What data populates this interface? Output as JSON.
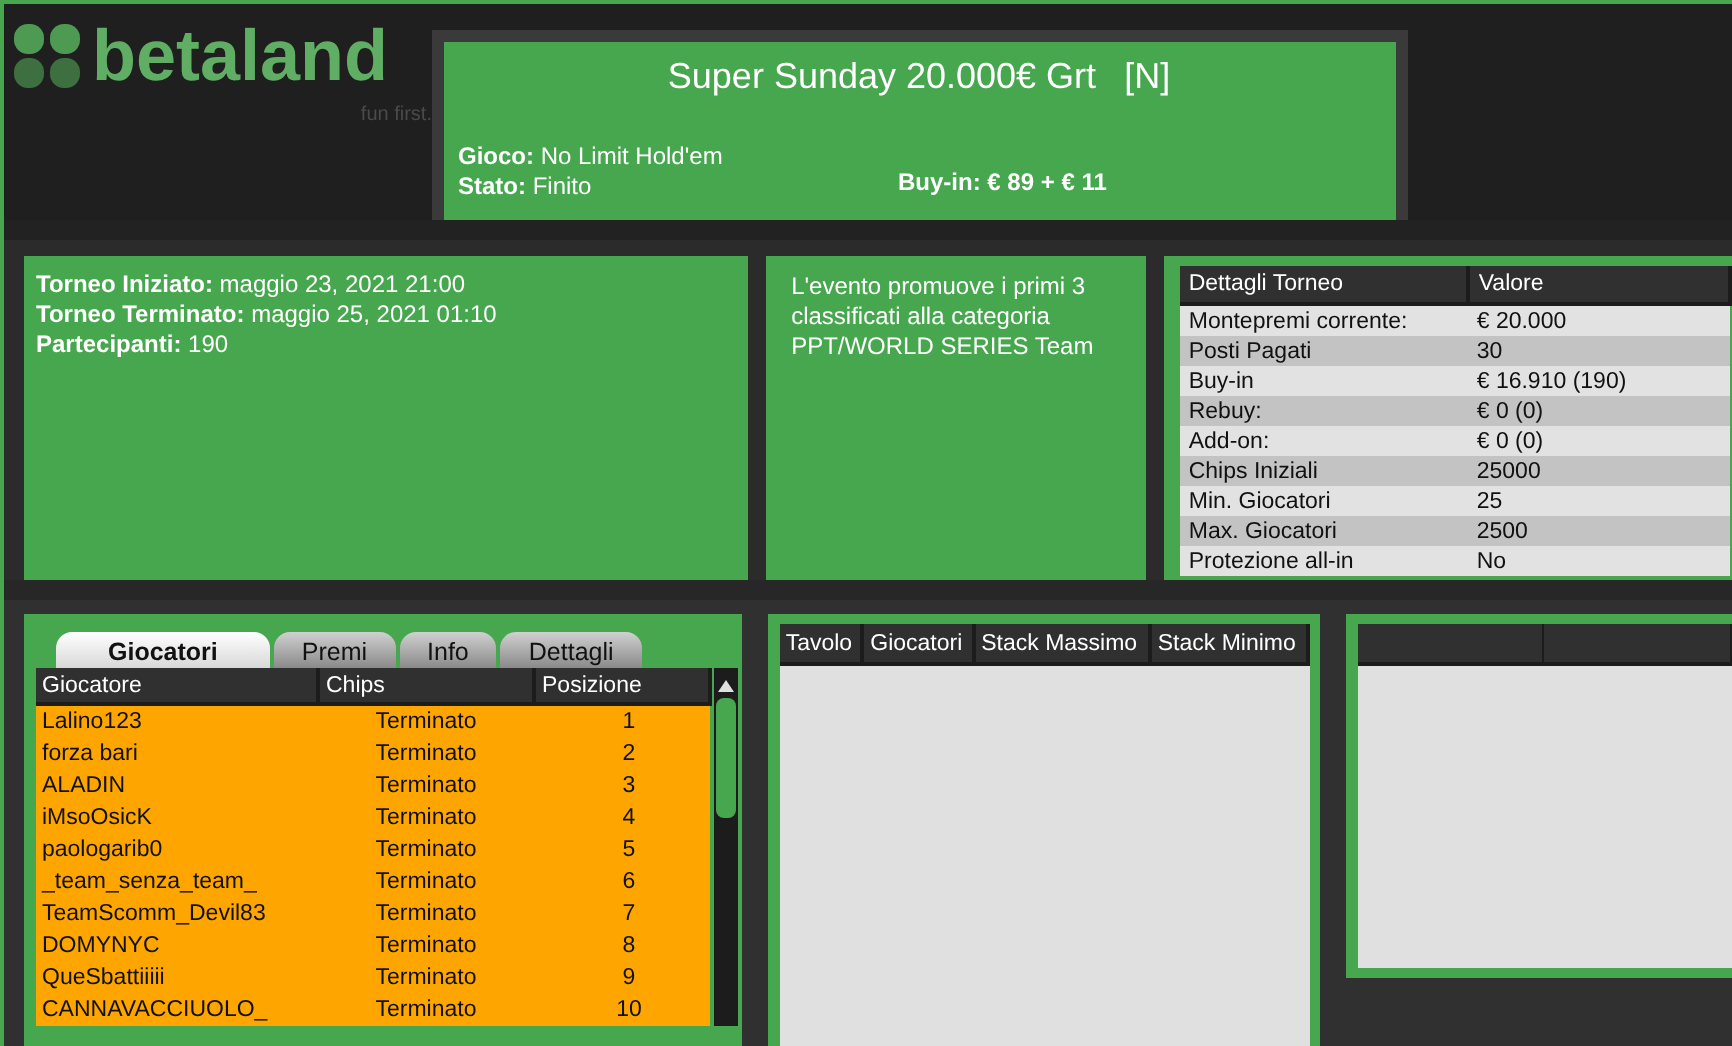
{
  "logo": {
    "name": "betaland",
    "tagline": "fun first."
  },
  "tournament": {
    "title": "Super Sunday 20.000€ Grt",
    "tag": "[N]",
    "info": [
      "**Gioco:** No Limit Hold'em",
      "**Stato:** Finito"
    ],
    "buy_in": "Buy-in: € 89 + € 11"
  },
  "schedule": [
    "**Torneo Iniziato:** maggio 23, 2021 21:00",
    "**Torneo Terminato:** maggio 25, 2021 01:10",
    "**Partecipanti:** 190"
  ],
  "description": "L'evento promuove i primi 3 classificati alla categoria PPT/WORLD SERIES Team",
  "details_table": {
    "columns": [
      "Dettagli Torneo",
      "Valore"
    ],
    "rows": [
      [
        "Montepremi corrente:",
        "€ 20.000"
      ],
      [
        "Posti Pagati",
        "30"
      ],
      [
        "Buy-in",
        "€ 16.910 (190)"
      ],
      [
        "Rebuy:",
        "€ 0 (0)"
      ],
      [
        "Add-on:",
        "€ 0 (0)"
      ],
      [
        "Chips Iniziali",
        "25000"
      ],
      [
        "Min. Giocatori",
        "25"
      ],
      [
        "Max. Giocatori",
        "2500"
      ],
      [
        "Protezione all-in",
        "No"
      ]
    ]
  },
  "player_tabs": [
    {
      "label": "Giocatori",
      "selected": true
    },
    {
      "label": "Premi",
      "selected": false
    },
    {
      "label": "Info",
      "selected": false
    },
    {
      "label": "Dettagli",
      "selected": false
    }
  ],
  "players_table": {
    "columns": [
      "Giocatore",
      "Chips",
      "Posizione"
    ],
    "rows": [
      [
        "Lalino123",
        "Terminato",
        "1"
      ],
      [
        "forza bari",
        "Terminato",
        "2"
      ],
      [
        "ALADIN",
        "Terminato",
        "3"
      ],
      [
        "iMsoOsicK",
        "Terminato",
        "4"
      ],
      [
        "paologarib0",
        "Terminato",
        "5"
      ],
      [
        "_team_senza_team_",
        "Terminato",
        "6"
      ],
      [
        "TeamScomm_Devil83",
        "Terminato",
        "7"
      ],
      [
        "DOMYNYC",
        "Terminato",
        "8"
      ],
      [
        "QueSbattiiiii",
        "Terminato",
        "9"
      ],
      [
        "CANNAVACCIUOLO_",
        "Terminato",
        "10"
      ]
    ]
  },
  "tables_list": {
    "columns": [
      "Tavolo",
      "Giocatori",
      "Stack Massimo",
      "Stack Minimo"
    ]
  }
}
